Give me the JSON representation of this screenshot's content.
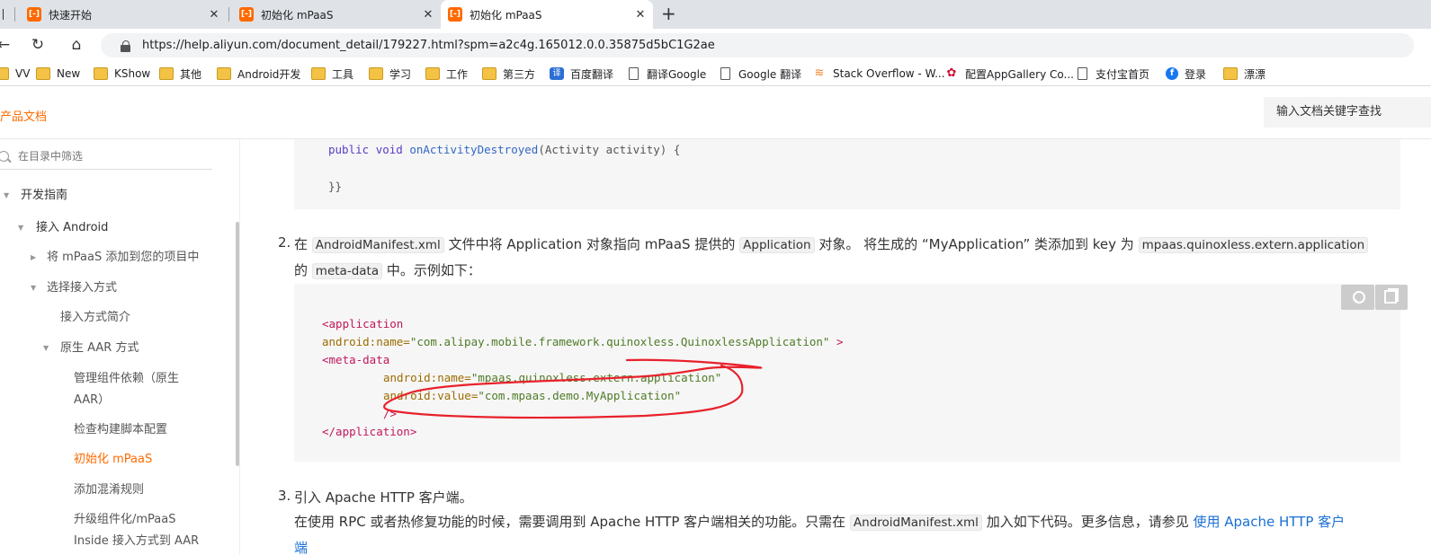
{
  "tabs": [
    {
      "label": "快速开始"
    },
    {
      "label": "初始化 mPaaS"
    },
    {
      "label": "初始化 mPaaS"
    }
  ],
  "tab_favicon_glyph": "[-]",
  "address": {
    "url": "https://help.aliyun.com/document_detail/179227.html?spm=a2c4g.165012.0.0.35875d5bC1G2ae"
  },
  "bookmarks": [
    {
      "label": "VV",
      "icon": "folder"
    },
    {
      "label": "New",
      "icon": "folder"
    },
    {
      "label": "KShow",
      "icon": "folder"
    },
    {
      "label": "其他",
      "icon": "folder"
    },
    {
      "label": "Android开发",
      "icon": "folder"
    },
    {
      "label": "工具",
      "icon": "folder"
    },
    {
      "label": "学习",
      "icon": "folder"
    },
    {
      "label": "工作",
      "icon": "folder"
    },
    {
      "label": "第三方",
      "icon": "folder"
    },
    {
      "label": "百度翻译",
      "icon": "translate"
    },
    {
      "label": "翻译Google",
      "icon": "page"
    },
    {
      "label": "Google 翻译",
      "icon": "page"
    },
    {
      "label": "Stack Overflow - W...",
      "icon": "stackoverflow"
    },
    {
      "label": "配置AppGallery Co...",
      "icon": "huawei"
    },
    {
      "label": "支付宝首页",
      "icon": "page"
    },
    {
      "label": "登录",
      "icon": "facebook"
    },
    {
      "label": "漂漂",
      "icon": "folder"
    }
  ],
  "header": {
    "brand": "产品文档",
    "search_placeholder": "输入文档关键字查找"
  },
  "sidebar": {
    "filter_placeholder": "在目录中筛选",
    "items": [
      {
        "label": "开发指南"
      },
      {
        "label": "接入 Android"
      },
      {
        "label": "将 mPaaS 添加到您的项目中"
      },
      {
        "label": "选择接入方式"
      },
      {
        "label": "接入方式简介"
      },
      {
        "label": "原生 AAR 方式"
      },
      {
        "label": "管理组件依赖（原生"
      },
      {
        "label": "AAR）"
      },
      {
        "label": "检查构建脚本配置"
      },
      {
        "label": "初始化 mPaaS"
      },
      {
        "label": "添加混淆规则"
      },
      {
        "label": "升级组件化/mPaaS"
      },
      {
        "label": "Inside 接入方式到 AAR"
      }
    ]
  },
  "content": {
    "code1": {
      "l1_kw1": "public",
      "l1_kw2": "void",
      "l1_fn": "onActivityDestroyed",
      "l1_rest": "(Activity activity) {",
      "l2": "}}"
    },
    "step2": {
      "num": "2.",
      "t1": "在",
      "c1": "AndroidManifest.xml",
      "t2": "文件中将 Application 对象指向 mPaaS 提供的",
      "c2": "Application",
      "t3": "对象。 将生成的 “MyApplication” 类添加到 key 为",
      "c3": "mpaas.quinoxless.extern.application",
      "t4": "的",
      "c4": "meta-data",
      "t5": "中。示例如下："
    },
    "code2": {
      "l1_tag": "<application",
      "l2_attr": "android:name=",
      "l2_str": "\"com.alipay.mobile.framework.quinoxless.QuinoxlessApplication\"",
      "l2_end": " >",
      "l3_tag": "<meta-data",
      "l4_attr": "android:name=",
      "l4_str": "\"mpaas.quinoxless.extern.application\"",
      "l5_attr": "android:value=",
      "l5_str": "\"com.mpaas.demo.MyApplication\"",
      "l6_tag": "/>",
      "l7_tag": "</application>"
    },
    "step3": {
      "num": "3.",
      "title": "引入 Apache HTTP 客户端。",
      "t1": "在使用 RPC 或者热修复功能的时候，需要调用到 Apache HTTP 客户端相关的功能。只需在",
      "c1": "AndroidManifest.xml",
      "t2": "加入如下代码。更多信息，请参见",
      "link": "使用 Apache HTTP 客户",
      "link2": "端"
    }
  },
  "colors": {
    "accent": "#ff6a00",
    "link": "#1a6fd6",
    "annotation": "#e8212b"
  }
}
